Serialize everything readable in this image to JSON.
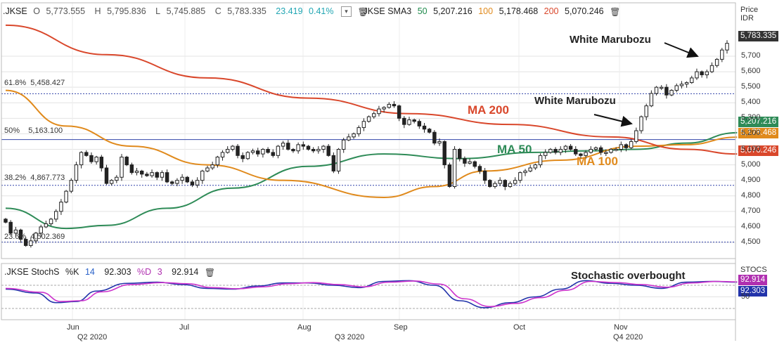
{
  "header": {
    "symbol": ".JKSE",
    "open_label": "O",
    "open": "5,773.555",
    "high_label": "H",
    "high": "5,795.836",
    "low_label": "L",
    "low": "5,745.885",
    "close_label": "C",
    "close": "5,783.335",
    "change": "23.419",
    "change_pct": "0.41%",
    "sma_label": ".JKSE SMA3",
    "sma50_period": "50",
    "sma50_value": "5,207.216",
    "sma100_period": "100",
    "sma100_value": "5,178.468",
    "sma200_period": "200",
    "sma200_value": "5,070.246"
  },
  "stoch_header": {
    "label": ".JKSE StochS",
    "k_label": "%K",
    "k_period": "14",
    "k_value": "92.303",
    "d_label": "%D",
    "d_period": "3",
    "d_value": "92.914"
  },
  "price_axis": {
    "title": "Price",
    "currency": "IDR"
  },
  "stoch_axis": {
    "title": "STOCS"
  },
  "annotations": {
    "marubozu_1": "White Marubozu",
    "marubozu_2": "White Marubozu",
    "ma200": "MA 200",
    "ma50": "MA 50",
    "ma100": "MA 100",
    "stoch_overbought": "Stochastic overbought"
  },
  "fib_labels": {
    "f618": "61.8%  5,458.427",
    "f50": "50%    5,163.100",
    "f382": "38.2%  4,867.773",
    "f236": "23.6%  4,502.369"
  },
  "price_tags": {
    "last": "5,783.335",
    "sma50": "5,207.216",
    "sma100": "5,178.468",
    "sma200": "5,070.246"
  },
  "stoch_tags": {
    "d": "92.914",
    "k": "92.303"
  },
  "colors": {
    "up": "#ffffff",
    "down": "#222222",
    "ma50": "#2e8b57",
    "ma100": "#e08a1c",
    "ma200": "#d9472b",
    "stoch_k": "#2233aa",
    "stoch_d": "#cc33cc",
    "fib": "#3344aa"
  },
  "chart_data": [
    {
      "type": "candlestick",
      "title": ".JKSE",
      "ylabel": "Price IDR",
      "ylim": [
        4450,
        6000
      ],
      "yticks": [
        4500,
        4600,
        4700,
        4800,
        4900,
        5000,
        5100,
        5200,
        5300,
        5400,
        5500,
        5600,
        5700
      ],
      "xtick_labels": [
        "Jun",
        "Jul",
        "Aug",
        "Sep",
        "Oct",
        "Nov"
      ],
      "quarter_labels": [
        "Q2 2020",
        "Q3 2020",
        "Q4 2020"
      ],
      "fib_levels": [
        {
          "level": "61.8%",
          "value": 5458.427
        },
        {
          "level": "50%",
          "value": 5163.1
        },
        {
          "level": "38.2%",
          "value": 4867.773
        },
        {
          "level": "23.6%",
          "value": 4502.369
        }
      ],
      "candles_close": [
        4630,
        4560,
        4580,
        4520,
        4480,
        4510,
        4560,
        4600,
        4620,
        4650,
        4700,
        4760,
        4830,
        4900,
        5000,
        5080,
        5060,
        5020,
        5050,
        4980,
        4880,
        4900,
        4920,
        5050,
        5000,
        4950,
        4960,
        4940,
        4930,
        4950,
        4920,
        4950,
        4890,
        4880,
        4900,
        4920,
        4890,
        4870,
        4900,
        4960,
        4980,
        5000,
        5050,
        5080,
        5100,
        5120,
        5060,
        5040,
        5080,
        5090,
        5070,
        5100,
        5080,
        5060,
        5120,
        5140,
        5100,
        5090,
        5130,
        5120,
        5100,
        5090,
        5100,
        5120,
        5060,
        4960,
        5100,
        5160,
        5180,
        5200,
        5240,
        5280,
        5310,
        5330,
        5360,
        5370,
        5390,
        5380,
        5300,
        5260,
        5290,
        5280,
        5250,
        5230,
        5210,
        5140,
        5150,
        5000,
        4860,
        5100,
        5040,
        5010,
        5020,
        4990,
        4960,
        4900,
        4860,
        4880,
        4900,
        4860,
        4880,
        4900,
        4950,
        4960,
        4980,
        5000,
        5060,
        5080,
        5100,
        5080,
        5100,
        5120,
        5100,
        5070,
        5060,
        5080,
        5100,
        5110,
        5080,
        5080,
        5100,
        5100,
        5130,
        5110,
        5150,
        5220,
        5310,
        5380,
        5460,
        5500,
        5500,
        5450,
        5480,
        5510,
        5520,
        5530,
        5560,
        5600,
        5580,
        5600,
        5640,
        5680,
        5740,
        5783
      ],
      "series": [
        {
          "name": "MA 50",
          "x": [
            0,
            12,
            20,
            32,
            45,
            60,
            75,
            90,
            105,
            115,
            125,
            135,
            145
          ],
          "values": [
            4720,
            4590,
            4610,
            4720,
            4850,
            4990,
            5070,
            5040,
            5080,
            5090,
            5100,
            5140,
            5207
          ]
        },
        {
          "name": "MA 100",
          "x": [
            0,
            12,
            25,
            40,
            55,
            75,
            85,
            95,
            110,
            125,
            135,
            145
          ],
          "values": [
            5480,
            5250,
            5120,
            5000,
            4900,
            4790,
            4860,
            4960,
            5030,
            5120,
            5130,
            5178
          ]
        },
        {
          "name": "MA 200",
          "x": [
            0,
            20,
            40,
            60,
            80,
            100,
            120,
            135,
            145
          ],
          "values": [
            5900,
            5710,
            5560,
            5430,
            5330,
            5260,
            5180,
            5100,
            5070
          ]
        }
      ]
    },
    {
      "type": "line",
      "title": ".JKSE StochS",
      "ylim": [
        0,
        100
      ],
      "yticks": [
        50
      ],
      "series": [
        {
          "name": "%K",
          "x": [
            0,
            6,
            10,
            14,
            18,
            24,
            30,
            35,
            40,
            45,
            50,
            55,
            60,
            65,
            70,
            75,
            80,
            85,
            90,
            95,
            100,
            105,
            110,
            115,
            120,
            125,
            130,
            135,
            140,
            145
          ],
          "values": [
            70,
            60,
            35,
            38,
            65,
            85,
            88,
            82,
            72,
            70,
            78,
            86,
            86,
            80,
            74,
            90,
            92,
            80,
            40,
            22,
            35,
            50,
            70,
            92,
            85,
            80,
            72,
            88,
            90,
            88
          ]
        },
        {
          "name": "%D",
          "x": [
            0,
            7,
            11,
            15,
            19,
            25,
            31,
            36,
            41,
            46,
            51,
            56,
            61,
            66,
            71,
            76,
            81,
            86,
            91,
            96,
            101,
            106,
            111,
            116,
            121,
            126,
            131,
            136,
            141,
            145
          ],
          "values": [
            72,
            62,
            38,
            40,
            63,
            82,
            87,
            84,
            74,
            71,
            76,
            84,
            87,
            82,
            76,
            88,
            91,
            83,
            45,
            25,
            33,
            48,
            67,
            90,
            87,
            82,
            75,
            86,
            90,
            89
          ]
        }
      ]
    }
  ]
}
